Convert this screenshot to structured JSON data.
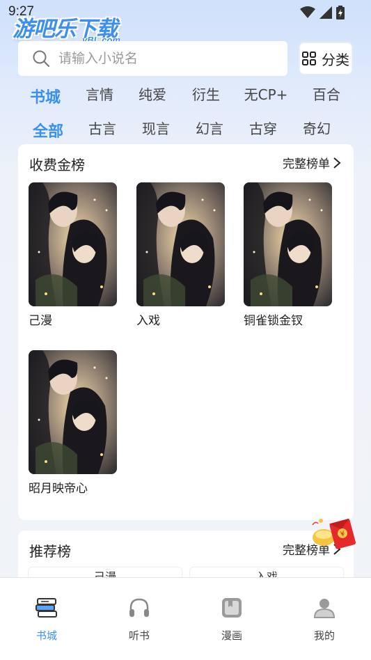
{
  "status_bar": {
    "time": "9:27"
  },
  "watermark": {
    "title": "游吧乐下载",
    "subtitle": "yBL.com"
  },
  "search": {
    "placeholder": "请输入小说名",
    "value": ""
  },
  "category_button": {
    "label": "分类",
    "icon": "grid-icon"
  },
  "channel_tabs": [
    {
      "label": "书城",
      "active": true
    },
    {
      "label": "言情",
      "active": false
    },
    {
      "label": "纯爱",
      "active": false
    },
    {
      "label": "衍生",
      "active": false
    },
    {
      "label": "无CP+",
      "active": false
    },
    {
      "label": "百合",
      "active": false
    }
  ],
  "genre_tabs": [
    {
      "label": "全部",
      "active": true
    },
    {
      "label": "古言",
      "active": false
    },
    {
      "label": "现言",
      "active": false
    },
    {
      "label": "幻言",
      "active": false
    },
    {
      "label": "古穿",
      "active": false
    },
    {
      "label": "奇幻",
      "active": false
    }
  ],
  "paid_ranking": {
    "title": "收费金榜",
    "more_label": "完整榜单",
    "books": [
      {
        "title": "己漫"
      },
      {
        "title": "入戏"
      },
      {
        "title": "铜雀锁金钗"
      },
      {
        "title": "昭月映帝心"
      }
    ]
  },
  "recommend_ranking": {
    "title": "推荐榜",
    "more_label": "完整榜单",
    "items": [
      {
        "title": "己漫"
      },
      {
        "title": "入戏"
      }
    ]
  },
  "bottom_nav": [
    {
      "label": "书城",
      "icon": "books-icon",
      "active": true
    },
    {
      "label": "听书",
      "icon": "headphones-icon",
      "active": false
    },
    {
      "label": "漫画",
      "icon": "comic-icon",
      "active": false
    },
    {
      "label": "我的",
      "icon": "profile-icon",
      "active": false
    }
  ],
  "colors": {
    "accent": "#3a8ff2",
    "background": "#eef2f8"
  }
}
